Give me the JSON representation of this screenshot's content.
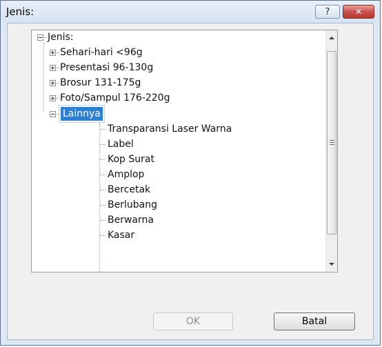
{
  "window": {
    "title": "Jenis:",
    "help_glyph": "?",
    "close_glyph": "✕"
  },
  "tree": {
    "root": {
      "label": "Jenis:",
      "expanded": true
    },
    "categories": [
      {
        "label": "Sehari-hari <96g",
        "expanded": false
      },
      {
        "label": "Presentasi 96-130g",
        "expanded": false
      },
      {
        "label": "Brosur 131-175g",
        "expanded": false
      },
      {
        "label": "Foto/Sampul 176-220g",
        "expanded": false
      },
      {
        "label": "Lainnya",
        "expanded": true,
        "selected": true
      }
    ],
    "children": [
      "Transparansi Laser Warna",
      "Label",
      "Kop Surat",
      "Amplop",
      "Bercetak",
      "Berlubang",
      "Berwarna",
      "Kasar"
    ]
  },
  "scrollbar": {
    "grip_glyph": "≡"
  },
  "buttons": {
    "ok_label": "OK",
    "ok_enabled": false,
    "cancel_label": "Batal"
  },
  "colors": {
    "selection": "#2f7fd1",
    "close_button": "#c75050",
    "dialog_frame": "#dfe9f6"
  }
}
